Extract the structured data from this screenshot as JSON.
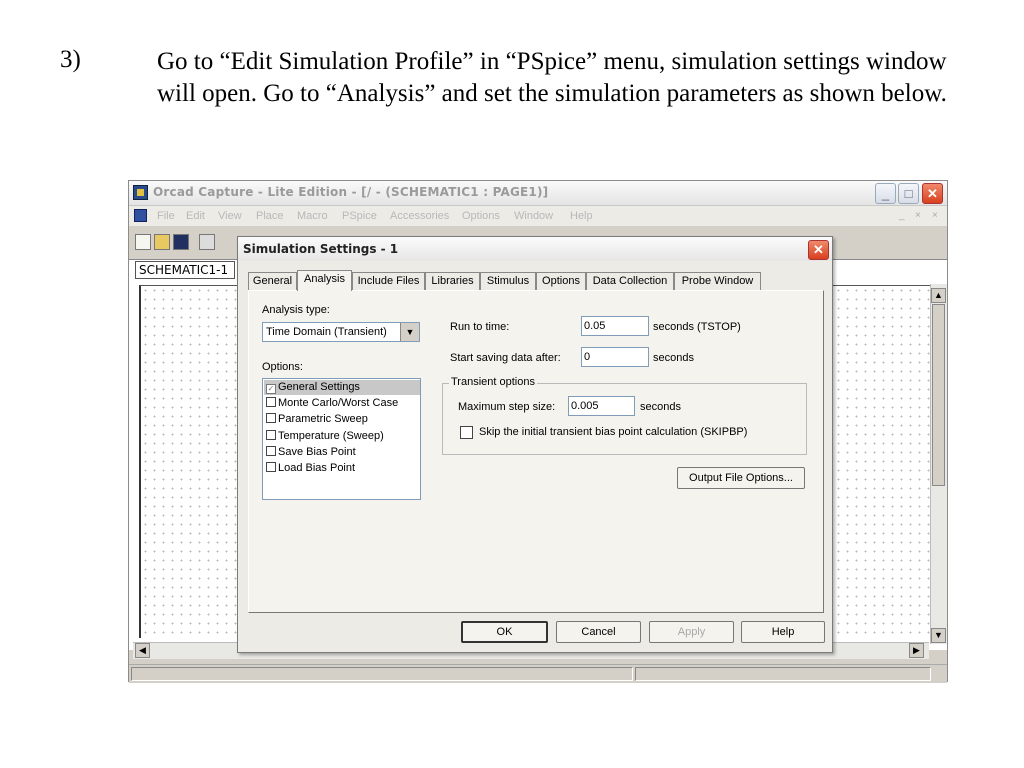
{
  "slide": {
    "number": "3)",
    "text": "Go to “Edit Simulation Profile” in “PSpice” menu, simulation settings window will open. Go to “Analysis” and set the simulation parameters as shown below."
  },
  "app": {
    "title": "Orcad Capture - Lite Edition - [/ - (SCHEMATIC1 : PAGE1)]",
    "window_controls": {
      "minimize": "_",
      "maximize": "□",
      "close": "✕"
    },
    "menu": [
      "File",
      "Edit",
      "View",
      "Place",
      "Macro",
      "PSpice",
      "Accessories",
      "Options",
      "Window",
      "Help"
    ],
    "mdi_controls": [
      "_",
      "×",
      "×"
    ],
    "document_tab": "SCHEMATIC1-1"
  },
  "dialog": {
    "title": "Simulation Settings - 1",
    "close": "✕",
    "tabs": [
      "General",
      "Analysis",
      "Include Files",
      "Libraries",
      "Stimulus",
      "Options",
      "Data Collection",
      "Probe Window"
    ],
    "active_tab": "Analysis",
    "analysis_type_label": "Analysis type:",
    "analysis_type_value": "Time Domain (Transient)",
    "options_label": "Options:",
    "options": [
      {
        "label": "General Settings",
        "checked": true,
        "selected": true
      },
      {
        "label": "Monte Carlo/Worst Case",
        "checked": false
      },
      {
        "label": "Parametric Sweep",
        "checked": false
      },
      {
        "label": "Temperature (Sweep)",
        "checked": false
      },
      {
        "label": "Save Bias Point",
        "checked": false
      },
      {
        "label": "Load Bias Point",
        "checked": false
      }
    ],
    "run_to_time_label": "Run to time:",
    "run_to_time_value": "0.05",
    "run_to_time_unit": "seconds  (TSTOP)",
    "start_saving_label": "Start saving data after:",
    "start_saving_value": "0",
    "start_saving_unit": "seconds",
    "transient_group_title": "Transient options",
    "max_step_label": "Maximum step size:",
    "max_step_value": "0.005",
    "max_step_unit": "seconds",
    "skip_bias_label": "Skip the initial transient bias point calculation  (SKIPBP)",
    "output_file_button": "Output File Options...",
    "buttons": {
      "ok": "OK",
      "cancel": "Cancel",
      "apply": "Apply",
      "help": "Help"
    }
  }
}
